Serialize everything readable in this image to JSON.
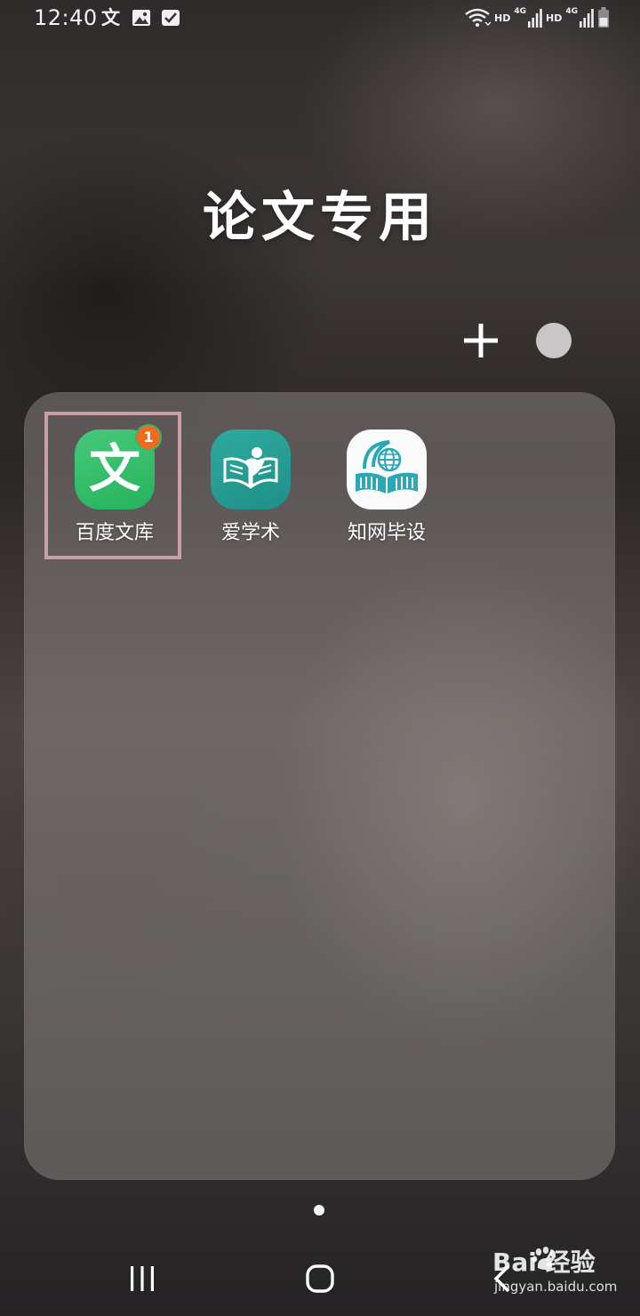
{
  "status_bar": {
    "time": "12:40",
    "notification_wen": "文",
    "hd1": "HD",
    "net1": "4G",
    "hd2": "HD",
    "net2": "4G"
  },
  "folder": {
    "title": "论文专用",
    "apps": [
      {
        "label": "百度文库",
        "icon_glyph": "文",
        "badge": "1",
        "icon_color": "#33bd68"
      },
      {
        "label": "爱学术",
        "icon_color": "#26a096"
      },
      {
        "label": "知网毕设",
        "icon_color": "#ffffff"
      }
    ]
  },
  "icons": {
    "add": "plus-icon",
    "color": "color-circle-icon",
    "recents": "recents-icon",
    "home": "home-icon",
    "back": "back-icon"
  },
  "watermark": {
    "brand": "Bai  经验",
    "url": "jingyan.baidu.com"
  }
}
